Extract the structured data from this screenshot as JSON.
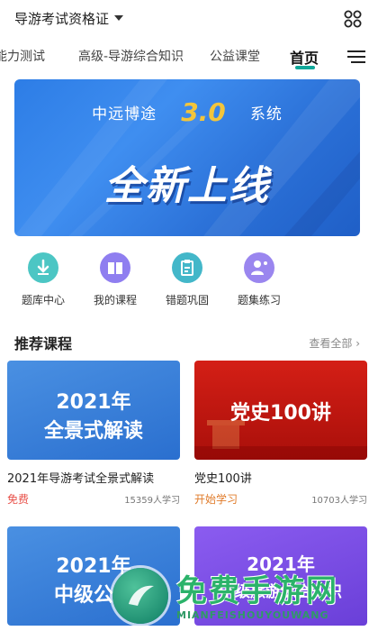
{
  "header": {
    "title": "导游考试资格证",
    "apps_icon": "grid-apps-icon"
  },
  "tabs": [
    {
      "label": "能力测试"
    },
    {
      "label": "高级-导游综合知识"
    },
    {
      "label": "公益课堂"
    },
    {
      "label": "首页",
      "active": true
    }
  ],
  "menu_icon": "menu-lines-icon",
  "banner": {
    "brand": "中远博途",
    "version": "3.0",
    "system": "系统",
    "headline": "全新上线"
  },
  "quick_links": [
    {
      "label": "题库中心",
      "icon": "download-icon",
      "color": "#4cc6c4"
    },
    {
      "label": "我的课程",
      "icon": "book-icon",
      "color": "#8f7ef0"
    },
    {
      "label": "错题巩固",
      "icon": "clipboard-icon",
      "color": "#43b7c9"
    },
    {
      "label": "题集练习",
      "icon": "user-practice-icon",
      "color": "#9a86ef"
    }
  ],
  "section": {
    "title": "推荐课程",
    "view_all": "查看全部 ›"
  },
  "courses": [
    {
      "image_line1": "2021年",
      "image_line2": "全景式解读",
      "title": "2021年导游考试全景式解读",
      "tag": "免费",
      "tag_color": "#e8514a",
      "learners": "15359人学习"
    },
    {
      "image_line1": "党史100讲",
      "title": "党史100讲",
      "tag": "开始学习",
      "tag_color": "#e07b2a",
      "learners": "10703人学习"
    },
    {
      "image_line1": "2021年",
      "image_line2": "中级公共",
      "title": ""
    },
    {
      "image_line1": "2021年",
      "image_line2": "中级旅游综合知识",
      "title": ""
    }
  ],
  "watermark": {
    "text": "免费手游网",
    "sub": "MIANFEISHOUYOUWANG"
  }
}
